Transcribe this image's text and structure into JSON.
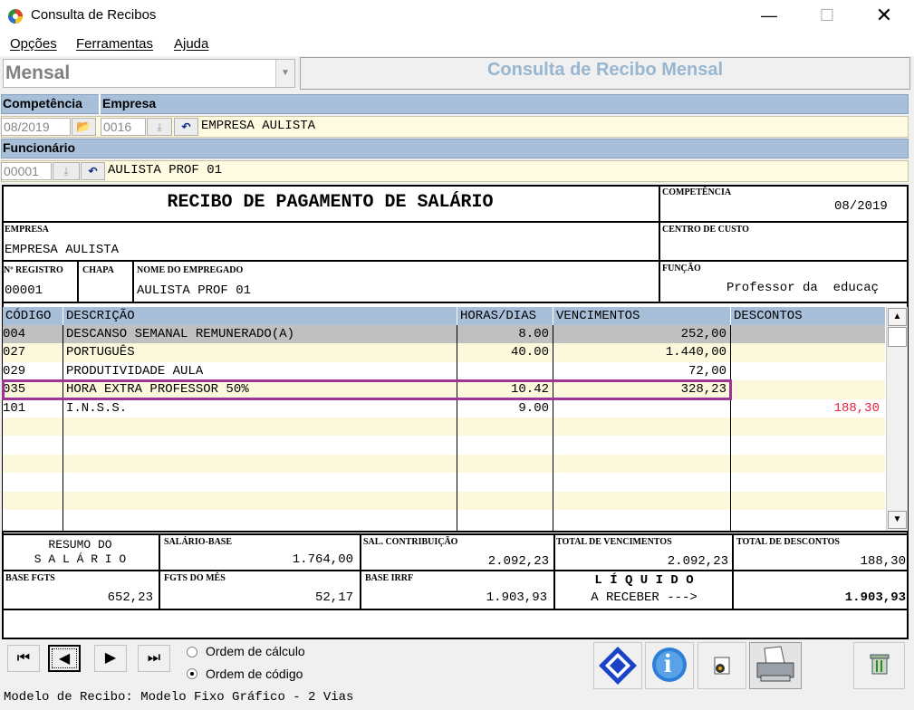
{
  "window": {
    "title": "Consulta de Recibos",
    "minimize": "—",
    "maximize": "☐",
    "close": "✕"
  },
  "menu": [
    "Opções",
    "Ferramentas",
    "Ajuda"
  ],
  "mode": {
    "value": "Mensal",
    "arrow": "▼"
  },
  "header": {
    "title": "Consulta de Recibo Mensal"
  },
  "filters": {
    "competencia_label": "Competência",
    "empresa_label": "Empresa",
    "competencia_value": "08/2019",
    "empresa_code": "0016",
    "empresa_name": "EMPRESA AULISTA",
    "funcionario_label": "Funcionário",
    "funcionario_code": "00001",
    "funcionario_name": "AULISTA PROF 01",
    "download_icon": "⤓",
    "undo_icon": "↶",
    "folder_icon": "📂"
  },
  "receipt": {
    "title": "RECIBO DE PAGAMENTO DE SALÁRIO",
    "competencia_label": "COMPETÊNCIA",
    "competencia_value": "08/2019",
    "empresa_label": "EMPRESA",
    "empresa_value": "EMPRESA AULISTA",
    "centro_label": "CENTRO DE CUSTO",
    "registro_label": "Nº REGISTRO",
    "registro_value": "00001",
    "chapa_label": "CHAPA",
    "nome_label": "NOME DO EMPREGADO",
    "nome_value": "AULISTA PROF 01",
    "funcao_label": "FUNÇÃO",
    "funcao_value": "Professor da  educaç"
  },
  "grid": {
    "headers": [
      "CÓDIGO",
      "DESCRIÇÃO",
      "HORAS/DIAS",
      "VENCIMENTOS",
      "DESCONTOS"
    ],
    "rows": [
      [
        "004",
        "DESCANSO SEMANAL REMUNERADO(A)",
        "8.00",
        "252,00",
        ""
      ],
      [
        "027",
        "PORTUGUÊS",
        "40.00",
        "1.440,00",
        ""
      ],
      [
        "029",
        "PRODUTIVIDADE AULA",
        "",
        "72,00",
        ""
      ],
      [
        "035",
        "HORA EXTRA PROFESSOR 50%",
        "10.42",
        "328,23",
        ""
      ],
      [
        "101",
        "I.N.S.S.",
        "9.00",
        "",
        "188,30"
      ]
    ],
    "descontos_color": "#e8203c",
    "scroll_up": "▲",
    "scroll_down": "▼"
  },
  "summary": {
    "resumo_line1": "RESUMO DO",
    "resumo_line2": "S A L Á R I O",
    "salario_base_label": "SALÁRIO-BASE",
    "salario_base": "1.764,00",
    "sal_contribuicao_label": "SAL. CONTRIBUIÇÃO",
    "sal_contribuicao": "2.092,23",
    "total_vencimentos_label": "TOTAL DE VENCIMENTOS",
    "total_vencimentos": "2.092,23",
    "total_descontos_label": "TOTAL DE DESCONTOS",
    "total_descontos": "188,30",
    "base_fgts_label": "BASE FGTS",
    "base_fgts": "652,23",
    "fgts_mes_label": "FGTS DO MÊS",
    "fgts_mes": "52,17",
    "base_irrf_label": "BASE IRRF",
    "base_irrf": "1.903,93",
    "liquido_line1": "L Í Q U I D O",
    "liquido_line2": "A RECEBER --->",
    "liquido": "1.903,93"
  },
  "footer": {
    "nav_first": "⏮",
    "nav_prev": "◀",
    "nav_next": "▶",
    "nav_last": "⏭",
    "ordem_calculo": "Ordem de cálculo",
    "ordem_codigo": "Ordem de código",
    "info_icon": "i",
    "status": "Modelo de Recibo: Modelo Fixo Gráfico - 2 Vias"
  }
}
